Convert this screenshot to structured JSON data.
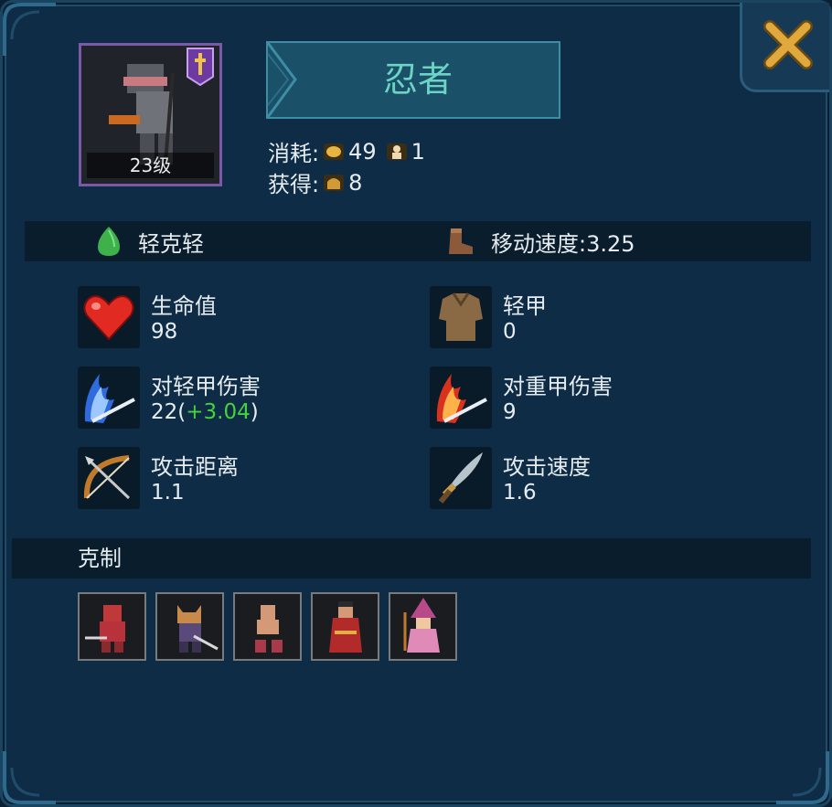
{
  "hero": {
    "name": "忍者",
    "level": "23级"
  },
  "cost": {
    "label": "消耗:",
    "gold": "49",
    "population": "1"
  },
  "gain": {
    "label": "获得:",
    "points": "8"
  },
  "info": {
    "matchup": "轻克轻",
    "move_speed": "移动速度:3.25"
  },
  "stats": {
    "hp": {
      "label": "生命值",
      "value": "98"
    },
    "armor": {
      "label": "轻甲",
      "value": "0"
    },
    "vs_light": {
      "label": "对轻甲伤害",
      "value": "22(",
      "bonus": "+3.04",
      "close": ")"
    },
    "vs_heavy": {
      "label": "对重甲伤害",
      "value": "9"
    },
    "range": {
      "label": "攻击距离",
      "value": "1.1"
    },
    "atk_speed": {
      "label": "攻击速度",
      "value": "1.6"
    }
  },
  "counters": {
    "title": "克制",
    "units": [
      "red-knight-unit-icon",
      "cat-swordsman-unit-icon",
      "martial-artist-unit-icon",
      "red-monk-unit-icon",
      "pink-witch-unit-icon"
    ]
  },
  "colors": {
    "bonus": "#44d33d",
    "title": "#6cd3c5",
    "portrait_border": "#7a5aa6"
  }
}
